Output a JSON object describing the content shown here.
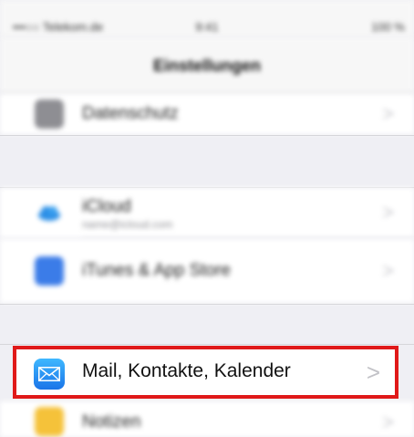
{
  "statusbar": {
    "carrier": "•••○○ Telekom.de",
    "time": "9:41",
    "battery": "100 %"
  },
  "navbar": {
    "title": "Einstellungen"
  },
  "rows": {
    "datenschutz": {
      "label": "Datenschutz"
    },
    "icloud": {
      "label": "iCloud",
      "sublabel": "name@icloud.com"
    },
    "itunes": {
      "label": "iTunes & App Store"
    },
    "mail": {
      "label": "Mail, Kontakte, Kalender"
    },
    "notizen": {
      "label": "Notizen"
    }
  },
  "chevron": ">",
  "colors": {
    "highlight_border": "#e01919",
    "mail_icon_top": "#3fb8ff",
    "mail_icon_bottom": "#1a74e8",
    "background": "#efeff4"
  }
}
